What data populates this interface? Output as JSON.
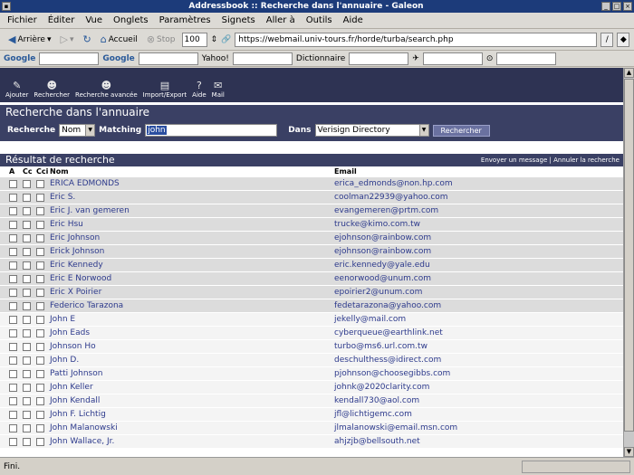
{
  "window": {
    "title": "Addressbook :: Recherche dans l'annuaire - Galeon"
  },
  "menu": [
    "Fichier",
    "Éditer",
    "Vue",
    "Onglets",
    "Paramètres",
    "Signets",
    "Aller à",
    "Outils",
    "Aide"
  ],
  "nav": {
    "back": "Arrière",
    "home": "Accueil",
    "stop": "Stop",
    "zoom": "100",
    "url": "https://webmail.univ-tours.fr/horde/turba/search.php"
  },
  "searchbar": {
    "google": "Google",
    "google_groups": "Google",
    "yahoo": "Yahoo!",
    "dictionnaire": "Dictionnaire"
  },
  "app_toolbar": [
    {
      "label": "Ajouter",
      "icon": "add-icon"
    },
    {
      "label": "Rechercher",
      "icon": "search-people-icon"
    },
    {
      "label": "Recherche avancée",
      "icon": "advanced-search-icon"
    },
    {
      "label": "Import/Export",
      "icon": "import-export-icon"
    },
    {
      "label": "Aide",
      "icon": "help-icon"
    },
    {
      "label": "Mail",
      "icon": "mail-icon"
    }
  ],
  "search": {
    "header": "Recherche dans l'annuaire",
    "field_label": "Recherche",
    "field_value": "Nom",
    "matching_label": "Matching",
    "matching_value": "john",
    "in_label": "Dans",
    "source": "Verisign Directory",
    "button": "Rechercher"
  },
  "results": {
    "header": "Résultat de recherche",
    "link_send": "Envoyer un message",
    "link_cancel": "Annuler la recherche",
    "col_a": "A",
    "col_cc": "Cc",
    "col_cci": "Cci",
    "col_name": "Nom",
    "col_email": "Email",
    "rows": [
      {
        "name": "ERICA EDMONDS",
        "email": "erica_edmonds@non.hp.com"
      },
      {
        "name": "Eric S.",
        "email": "coolman22939@yahoo.com"
      },
      {
        "name": "Eric J. van gemeren",
        "email": "evangemeren@prtm.com"
      },
      {
        "name": "Eric Hsu",
        "email": "trucke@kimo.com.tw"
      },
      {
        "name": "Eric Johnson",
        "email": "ejohnson@rainbow.com"
      },
      {
        "name": "Erick Johnson",
        "email": "ejohnson@rainbow.com"
      },
      {
        "name": "Eric Kennedy",
        "email": "eric.kennedy@yale.edu"
      },
      {
        "name": "Eric E Norwood",
        "email": "eenorwood@unum.com"
      },
      {
        "name": "Eric X Poirier",
        "email": "epoirier2@unum.com"
      },
      {
        "name": "Federico Tarazona",
        "email": "fedetarazona@yahoo.com"
      },
      {
        "name": "John E",
        "email": "jekelly@mail.com"
      },
      {
        "name": "John Eads",
        "email": "cyberqueue@earthlink.net"
      },
      {
        "name": "Johnson Ho",
        "email": "turbo@ms6.url.com.tw"
      },
      {
        "name": "John D.",
        "email": "deschulthess@idirect.com"
      },
      {
        "name": "Patti Johnson",
        "email": "pjohnson@choosegibbs.com"
      },
      {
        "name": "John Keller",
        "email": "johnk@2020clarity.com"
      },
      {
        "name": "John Kendall",
        "email": "kendall730@aol.com"
      },
      {
        "name": "John F. Lichtig",
        "email": "jfl@lichtigemc.com"
      },
      {
        "name": "John Malanowski",
        "email": "jlmalanowski@email.msn.com"
      },
      {
        "name": "John Wallace, Jr.",
        "email": "ahjzjb@bellsouth.net"
      }
    ]
  },
  "status": {
    "text": "Fini."
  }
}
